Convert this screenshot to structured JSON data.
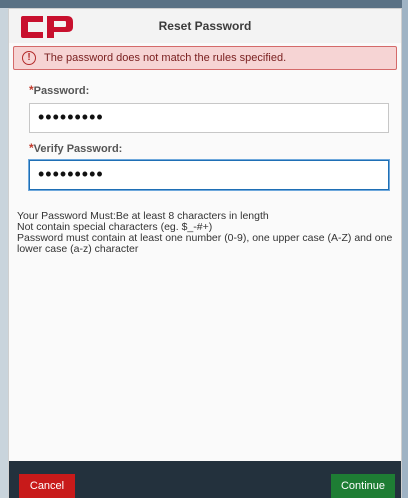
{
  "dialog": {
    "title": "Reset Password",
    "logo_text": "CP"
  },
  "error": {
    "icon": "alert-circle-icon",
    "text": "The password does not match the rules specified."
  },
  "form": {
    "password": {
      "required_mark": "*",
      "label": "Password:",
      "value": "•••••••••"
    },
    "verify": {
      "required_mark": "*",
      "label": "Verify Password:",
      "value": "•••••••••"
    }
  },
  "rules": {
    "line1": "Your Password Must:Be at least 8 characters in length",
    "line2": "Not contain special characters (eg. $_-#+)",
    "line3": "Password must contain at least one number (0-9), one upper case (A-Z) and one lower case (a-z) character"
  },
  "footer": {
    "cancel_label": "Cancel",
    "continue_label": "Continue"
  },
  "colors": {
    "brand_red": "#c8102e",
    "error_bg": "#f6d4d4",
    "cancel": "#c81a1a",
    "continue": "#1e7d34",
    "footer_bg": "#23313d"
  }
}
